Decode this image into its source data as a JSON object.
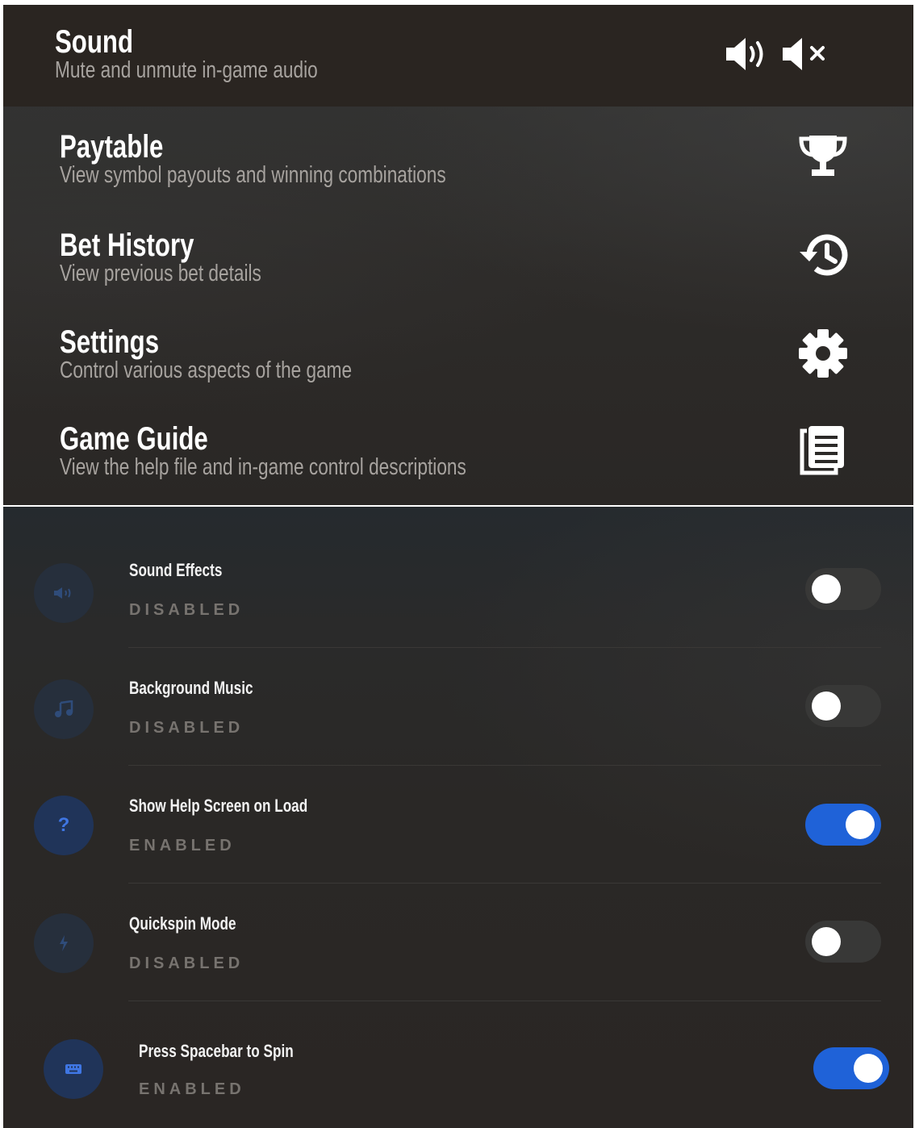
{
  "menu": {
    "sound": {
      "title": "Sound",
      "description": "Mute and unmute in-game audio",
      "icons": [
        "volume-on-icon",
        "volume-mute-icon"
      ]
    },
    "items": [
      {
        "title": "Paytable",
        "description": "View symbol payouts and winning combinations",
        "icon": "trophy-icon"
      },
      {
        "title": "Bet History",
        "description": "View previous bet details",
        "icon": "history-icon"
      },
      {
        "title": "Settings",
        "description": "Control various aspects of the game",
        "icon": "gear-icon"
      },
      {
        "title": "Game Guide",
        "description": "View the help file and in-game control descriptions",
        "icon": "document-icon"
      }
    ]
  },
  "settings": {
    "items": [
      {
        "title": "Sound Effects",
        "status": "DISABLED",
        "enabled": false,
        "icon": "speaker-icon"
      },
      {
        "title": "Background Music",
        "status": "DISABLED",
        "enabled": false,
        "icon": "music-note-icon"
      },
      {
        "title": "Show Help Screen on Load",
        "status": "ENABLED",
        "enabled": true,
        "icon": "question-icon"
      },
      {
        "title": "Quickspin Mode",
        "status": "DISABLED",
        "enabled": false,
        "icon": "lightning-icon"
      },
      {
        "title": "Press Spacebar to Spin",
        "status": "ENABLED",
        "enabled": true,
        "icon": "keyboard-icon"
      }
    ]
  },
  "colors": {
    "toggle_on": "#1f62d8",
    "toggle_off": "#383837",
    "icon_accent": "#3f76e3"
  }
}
